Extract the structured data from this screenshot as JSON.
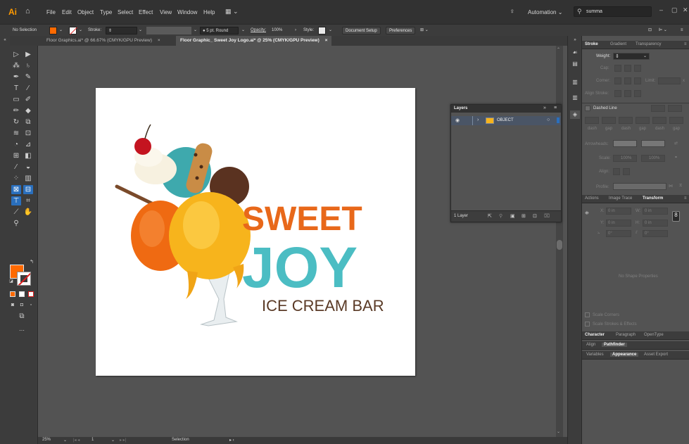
{
  "app": {
    "logo": "Ai",
    "home_icon": "home-icon"
  },
  "menu": [
    "File",
    "Edit",
    "Object",
    "Type",
    "Select",
    "Effect",
    "View",
    "Window",
    "Help"
  ],
  "topbar": {
    "workspace": "Automation",
    "search_value": "summa",
    "min": "–",
    "max": "▢",
    "close": "✕"
  },
  "control": {
    "selection": "No Selection",
    "stroke_label": "Stroke:",
    "brush": "5 pt. Round",
    "opacity_label": "Opacity:",
    "opacity_value": "100%",
    "style_label": "Style:",
    "doc_setup": "Document Setup",
    "preferences": "Preferences",
    "colors": {
      "fill": "#ff6a00",
      "stroke": "none"
    }
  },
  "tabs": [
    {
      "label": "Floor Graphics.ai* @ 66.67% (CMYK/GPU Preview)",
      "close": "×"
    },
    {
      "label": "Floor Graphic_ Sweet Joy Logo.ai* @ 25% (CMYK/GPU Preview)",
      "close": "×"
    }
  ],
  "artwork": {
    "line1": "SWEET",
    "line2": "JOY",
    "line3": "ICE CREAM BAR",
    "colors": {
      "orange": "#e8681a",
      "teal": "#4bbdc3",
      "brown": "#5a3a26"
    }
  },
  "layers_panel": {
    "title": "Layers",
    "layer_name": "OBJECT",
    "count": "1 Layer"
  },
  "status": {
    "zoom": "25%",
    "page": "1",
    "tool": "Selection"
  },
  "stroke_panel": {
    "tabs": [
      "Stroke",
      "Gradient",
      "Transparency"
    ],
    "weight_label": "Weight:",
    "cap_label": "Cap:",
    "corner_label": "Corner:",
    "limit_label": "Limit:",
    "limit_x": "x",
    "align_label": "Align Stroke:",
    "dashed": "Dashed Line",
    "dash_labels": [
      "dash",
      "gap",
      "dash",
      "gap",
      "dash",
      "gap"
    ],
    "arrowheads_label": "Arrowheads:",
    "scale_label": "Scale:",
    "scale1": "100%",
    "scale2": "100%",
    "align2_label": "Align:",
    "profile_label": "Profile:"
  },
  "transform_panel": {
    "tabs": [
      "Actions",
      "Image Trace",
      "Transform"
    ],
    "x_label": "X:",
    "x_val": "0 in",
    "y_label": "Y:",
    "y_val": "0 in",
    "w_label": "W:",
    "w_val": "0 in",
    "h_label": "H:",
    "h_val": "0 in",
    "angle_val": "0°",
    "shear_val": "0°",
    "no_shape": "No Shape Properties",
    "scale_corners": "Scale Corners",
    "scale_strokes": "Scale Strokes & Effects"
  },
  "char_tabs": [
    "Character",
    "Paragraph",
    "OpenType"
  ],
  "align_tabs": [
    "Align",
    "Pathfinder"
  ],
  "misc_tabs": [
    "Variables",
    "Appearance",
    "Asset Export"
  ]
}
